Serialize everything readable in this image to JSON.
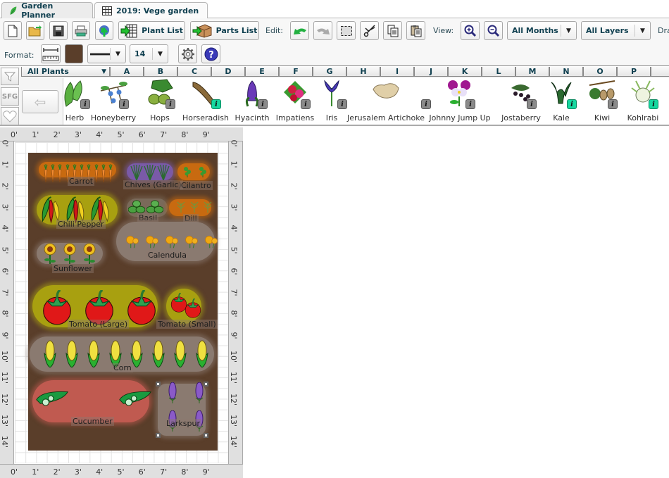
{
  "tabs": [
    {
      "label": "Garden Planner",
      "icon": "leaf-icon",
      "active": false
    },
    {
      "label": "2019: Vege garden",
      "icon": "grid-icon",
      "active": true
    }
  ],
  "toolbar": {
    "plant_list_label": "Plant List",
    "parts_list_label": "Parts List",
    "edit_label": "Edit:",
    "view_label": "View:",
    "months_value": "All Months",
    "layers_value": "All Layers",
    "draw_label": "Dra",
    "format_label": "Format:",
    "font_size_value": "14",
    "fill_color": "#5a3e2a"
  },
  "plant_picker": {
    "filter_value": "All Plants",
    "sfg_label": "SFG",
    "letters": [
      "A",
      "B",
      "C",
      "D",
      "E",
      "F",
      "G",
      "H",
      "I",
      "J",
      "K",
      "L",
      "M",
      "N",
      "O",
      "P"
    ],
    "plants": [
      {
        "name": "Herb",
        "info": "gray"
      },
      {
        "name": "Honeyberry",
        "info": "gray"
      },
      {
        "name": "Hops",
        "info": "gray"
      },
      {
        "name": "Horseradish",
        "info": "green"
      },
      {
        "name": "Hyacinth",
        "info": "gray"
      },
      {
        "name": "Impatiens",
        "info": "gray"
      },
      {
        "name": "Iris",
        "info": "gray"
      },
      {
        "name": "Jerusalem Artichoke",
        "info": "gray"
      },
      {
        "name": "Johnny Jump Up",
        "info": "gray"
      },
      {
        "name": "Jostaberry",
        "info": "gray"
      },
      {
        "name": "Kale",
        "info": "green"
      },
      {
        "name": "Kiwi",
        "info": "gray"
      },
      {
        "name": "Kohlrabi",
        "info": "green"
      }
    ],
    "info_glyph": "i"
  },
  "rulers": {
    "horizontal": [
      "0'",
      "1'",
      "2'",
      "3'",
      "4'",
      "5'",
      "6'",
      "7'",
      "8'",
      "9'"
    ],
    "vertical": [
      "0'",
      "1'",
      "2'",
      "3'",
      "4'",
      "5'",
      "6'",
      "7'",
      "8'",
      "9'",
      "10'",
      "11'",
      "12'",
      "13'",
      "14'"
    ]
  },
  "garden": {
    "bed_color": "#5a3e2a",
    "plantings": [
      {
        "name": "Carrot",
        "count": 10,
        "glyph": "🥕"
      },
      {
        "name": "Chives (Garlic)",
        "count": 3,
        "glyph": "🌿"
      },
      {
        "name": "Cilantro",
        "count": 2,
        "glyph": "🌿"
      },
      {
        "name": "Chili Pepper",
        "count": 3,
        "glyph": "🌶"
      },
      {
        "name": "Basil",
        "count": 2,
        "glyph": "🌿"
      },
      {
        "name": "Dill",
        "count": 3,
        "glyph": "🌿"
      },
      {
        "name": "Calendula",
        "count": 5,
        "glyph": "🌼"
      },
      {
        "name": "Sunflower",
        "count": 3,
        "glyph": "🌻"
      },
      {
        "name": "Tomato (Large)",
        "count": 3,
        "glyph": "🍅"
      },
      {
        "name": "Tomato (Small)",
        "count": 2,
        "glyph": "🍅"
      },
      {
        "name": "Corn",
        "count": 8,
        "glyph": "🌽"
      },
      {
        "name": "Cucumber",
        "count": 2,
        "glyph": "🥒"
      },
      {
        "name": "Larkspur",
        "count": 4,
        "glyph": "🪻"
      }
    ]
  }
}
